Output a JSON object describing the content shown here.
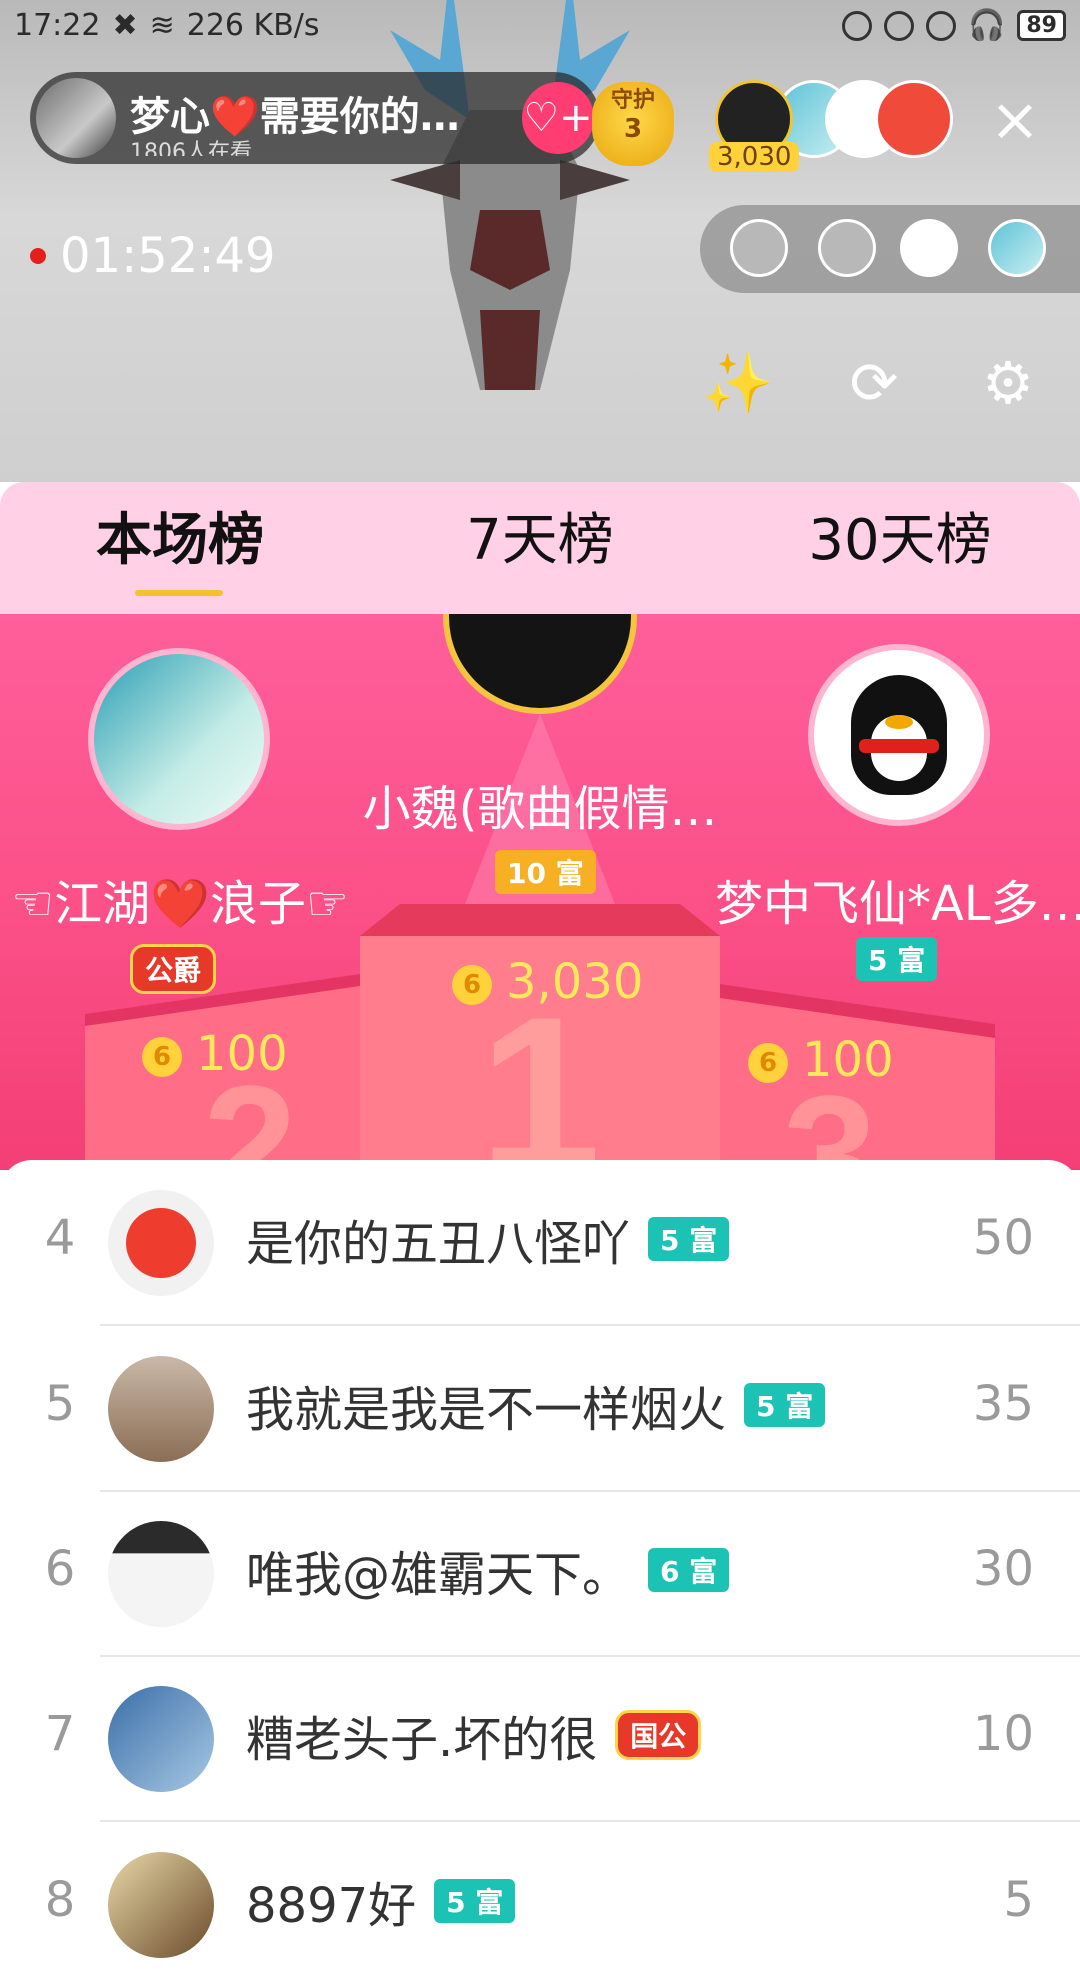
{
  "status_bar": {
    "time": "17:22",
    "net_speed": "226 KB/s",
    "battery": "89"
  },
  "host": {
    "name": "梦心❤️需要你的…",
    "viewers": "1806人在看",
    "guard_label": "守护",
    "guard_count": "3"
  },
  "viewer_top_coins": "3,030",
  "timer": "01:52:49",
  "tabs": [
    {
      "label": "本场榜"
    },
    {
      "label": "7天榜"
    },
    {
      "label": "30天榜"
    }
  ],
  "podium": {
    "first": {
      "name": "小魏(歌曲假情…",
      "badge": "10 富",
      "coins": "3,030"
    },
    "second": {
      "name": "☜江湖❤️浪子☞",
      "badge": "公爵",
      "coins": "100"
    },
    "third": {
      "name": "梦中飞仙*AL多…",
      "badge": "5 富",
      "coins": "100"
    },
    "ranks": [
      "1",
      "2",
      "3"
    ],
    "coin_symbol": "6"
  },
  "rows": [
    {
      "rank": "4",
      "name": "是你的五丑八怪吖",
      "badge": "5 富",
      "score": "50"
    },
    {
      "rank": "5",
      "name": "我就是我是不一样烟火",
      "badge": "5 富",
      "score": "35"
    },
    {
      "rank": "6",
      "name": "唯我@雄霸天下。",
      "badge": "6 富",
      "score": "30"
    },
    {
      "rank": "7",
      "name": "糟老头子.坏的很",
      "badge": "国公",
      "score": "10"
    },
    {
      "rank": "8",
      "name": "8897好",
      "badge": "5 富",
      "score": "5"
    }
  ],
  "icons": {
    "close": "×",
    "follow": "♡+",
    "magic": "✨",
    "camera": "⟳",
    "gear": "⚙"
  },
  "colors": {
    "tab_bg": "#ffd0e6",
    "podium_bg": "#fb4f87",
    "rich_badge": "#1cc3b4",
    "accent_gold": "#f7c02d"
  }
}
